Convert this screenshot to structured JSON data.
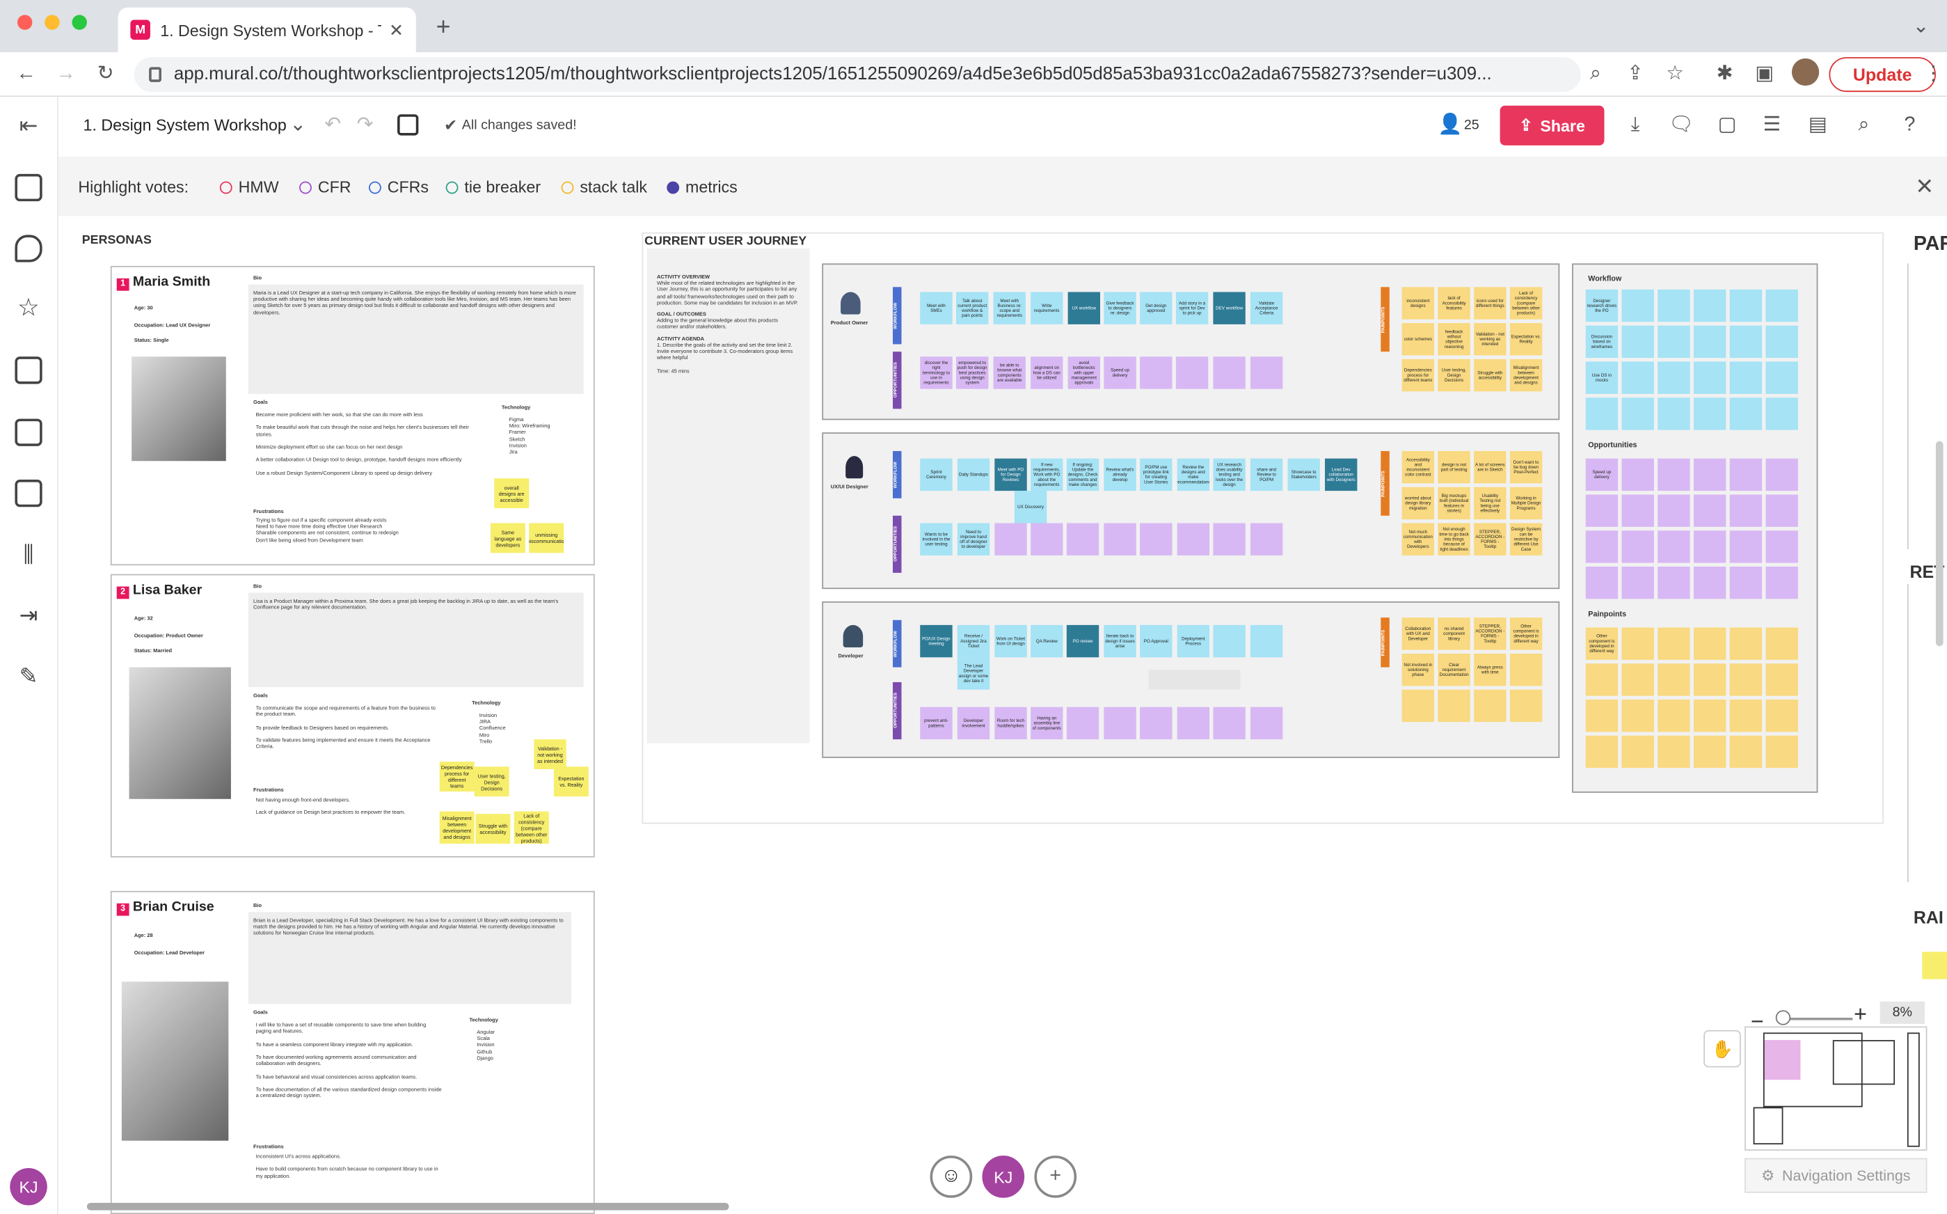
{
  "browser": {
    "tab_title": "1. Design System Workshop - T",
    "tab_favicon": "M",
    "url": "app.mural.co/t/thoughtworksclientprojects1205/m/thoughtworksclientprojects1205/1651255090269/a4d5e3e6b5d05d85a53ba931cc0a2ada67558273?sender=u309...",
    "update_label": "Update"
  },
  "app": {
    "room_title": "1. Design System Workshop",
    "saved_status": "All changes saved!",
    "collaborators_count": "25",
    "share_label": "Share",
    "user_initials": "KJ"
  },
  "votes": {
    "label": "Highlight votes:",
    "items": [
      {
        "label": "HMW",
        "color": "#e8365d"
      },
      {
        "label": "CFR",
        "color": "#a44ad1"
      },
      {
        "label": "CFRs",
        "color": "#3d6dd6"
      },
      {
        "label": "tie breaker",
        "color": "#2da287"
      },
      {
        "label": "stack talk",
        "color": "#f2b92b"
      },
      {
        "label": "metrics",
        "color": "#4b43a7"
      }
    ]
  },
  "canvas": {
    "personas_label": "PERSONAS",
    "journey_label": "CURRENT USER JOURNEY",
    "right_labels": [
      "PAR",
      "RET",
      "RAI"
    ],
    "personas": [
      {
        "num": "1",
        "name": "Maria Smith",
        "bio_label": "Bio",
        "age": "Age: 30",
        "occupation": "Occupation: Lead UX Designer",
        "status": "Status: Single",
        "bio": "Maria is a Lead UX Designer at a start-up tech company in California. She enjoys the flexibility of working remotely from home which is more productive with sharing her ideas and becoming quite handy with collaboration tools like Miro, Invision, and MS team. Her teams has been using Sketch for over 5 years as primary design tool but finds it difficult to collaborate and handoff designs with other designers and developers.",
        "goals_label": "Goals",
        "goals": [
          "Become more proficient with her work, so that she can do more with less",
          "To make beautiful work that cuts through the noise and helps her client's businesses tell their stories.",
          "Minimize deployment effort so she can focus on her next design",
          "A better collaboration UI Design tool to design, prototype, handoff designs more efficiently",
          "Use a robust Design System/Component Library to speed up design delivery"
        ],
        "tech_label": "Technology",
        "tech": [
          "Figma",
          "Miro: Wireframing",
          "Framer",
          "Sketch",
          "Invision",
          "Jira"
        ],
        "frustrations_label": "Frustrations",
        "frustrations": [
          "Trying to figure out if a specific component already exists",
          "Need to have more time doing effective User Research",
          "Sharable components are not consistent, continue to redesign",
          "Don't like being siloed from Development team"
        ],
        "stickies": [
          "overall designs are accessible",
          "Same language as developers",
          "unmissing miscommunication"
        ]
      },
      {
        "num": "2",
        "name": "Lisa Baker",
        "bio_label": "Bio",
        "age": "Age: 32",
        "occupation": "Occupation: Product Owner",
        "status": "Status: Married",
        "bio": "Lisa is a Product Manager within a Proxima team. She does a great job keeping the backlog in JIRA up to date, as well as the team's Confluence page for any relevent documentation.",
        "goals_label": "Goals",
        "goals": [
          "To communicate the scope and requirements of a feature from the business to the product team.",
          "To provide feedback to Designers based on requirements.",
          "To validate features being implemented and ensure it meets the Acceptance Criteria."
        ],
        "tech_label": "Technology",
        "tech": [
          "Invision",
          "JIRA",
          "Confluence",
          "Miro",
          "Trello"
        ],
        "frustrations_label": "Frustrations",
        "frustrations": [
          "Not having enough front-end developers.",
          "Lack of guidance on Design best practices to empower the team."
        ],
        "stickies": [
          "Validation - not working as intended",
          "Dependencies process for different teams",
          "User testing, Design Decisions",
          "Expectation vs. Reality",
          "Misalignment between development and designs",
          "Struggle with accessibility",
          "Lack of consistency (compare between other products)"
        ]
      },
      {
        "num": "3",
        "name": "Brian Cruise",
        "bio_label": "Bio",
        "age": "Age: 28",
        "occupation": "Occupation: Lead Developer",
        "bio": "Brian is a Lead Developer, specializing in Full Stack Development. He has a love for a consistent UI library with existing components to match the designs provided to him. He has a history of working with Angular and Angular Material. He currently develops innovative solutions for Norwegian Cruise line internal products.",
        "goals_label": "Goals",
        "goals": [
          "I will like to have a set of reusable components to save time when building paging and features.",
          "To have a seamless component library integrate with my application.",
          "To have documented working agreements around communication and collaboration with designers.",
          "To have behavioral and visual consistencies across application teams.",
          "To have documentation of all the various standardized design components inside a centralized design system."
        ],
        "tech_label": "Technology",
        "tech": [
          "Angular",
          "Scala",
          "Invision",
          "Github",
          "Django"
        ],
        "frustrations_label": "Frustrations",
        "frustrations": [
          "Inconsistent UI's across applications.",
          "Have to build components from scratch because no component library to use in my application."
        ]
      }
    ],
    "journey_info": {
      "overview_label": "ACTIVITY OVERVIEW",
      "overview": "While most of the related technologies are highlighted in the User Journey, this is an opportunity for participates to list any and all tools/ frameworks/technologies used on their path to production. Some may be candidates for inclusion in an MVP.",
      "goal_label": "GOAL / OUTCOMES",
      "goal": "Adding to the general knowledge about this products customer and/or stakeholders.",
      "agenda_label": "ACTIVITY AGENDA",
      "agenda": "1. Describe the goals of the activity and set the time limit  2. Invite everyone to contribute  3. Co-moderators group items where helpful",
      "time": "Time: 45 mins"
    },
    "journey_rows": [
      {
        "role": "Product Owner",
        "workflow": [
          "Meet with SMEs",
          "Talk about current product workflow & pain points",
          "Meet with Business re: scope and requirements",
          "Write requirements",
          "UX workflow",
          "Give feedback to designers re: design",
          "Get design approved",
          "Add story in a sprint for Dev to pick up",
          "DEV workflow",
          "Validate Acceptance Criteria"
        ],
        "opportunities": [
          "discover the right terminology to use in requirements",
          "empowered to push for design best practices using design system",
          "be able to browse what components are available",
          "alignment on how a DS can be utilized",
          "avoid bottlenecks with upper management approvals",
          "Speed up delivery"
        ],
        "painpoints": [
          "inconsistent designs",
          "lack of Accessibility features",
          "icons used for different things",
          "Lack of consistency (compare between other products)",
          "color schemes",
          "feedback without objective reasoning",
          "Validation - not working as intended",
          "Expectation vs. Reality",
          "Dependencies process for different teams",
          "User testing, Design Decisions",
          "Struggle with accessibility",
          "Misalignment between development and designs"
        ]
      },
      {
        "role": "UX/UI Designer",
        "workflow": [
          "Sprint Ceremony",
          "Daily Standups",
          "Meet with PO for Design Reviews",
          "If new requirements, Work with PO about the requirements",
          "If ongoing: Update the designs, Check comments and make changes",
          "Review what's already develop",
          "PO/PM use prototype link for creating User Stories",
          "Review the designs and make recommendations",
          "UX research does usability testing and looks over the design",
          "share and Review to PO/PM",
          "Showcase to Stakeholders",
          "Lead Dev collaboration with Designers",
          "UX Discovery"
        ],
        "opportunities": [
          "Wants to be involved in the user testing",
          "Need to improve hand off of designer to developer"
        ],
        "painpoints": [
          "Accessibility and inconsistent color contrast",
          "design is not part of testing",
          "A lot of screens are in Sketch",
          "Don't want to be bog down Pixel-Perfect",
          "worried about design library migration",
          "Big mockups built (individual features in stories)",
          "Usability Testing not being use effectively",
          "Working in Multiple Design Programs",
          "Not much communication with Developers",
          "Not enough time to go back into things because of tight deadlines",
          "STEPPER, ACCORDION - FORMS - Tooltip",
          "Design System can be restrictive by different Use Case"
        ]
      },
      {
        "role": "Developer",
        "workflow": [
          "PO/UX Design meeting",
          "Receive / Assigned Jira Ticket",
          "Work on Ticket from UI design",
          "QA Review",
          "PO review",
          "Iterate back to design if issues arise",
          "PO Approval",
          "Deployment Process",
          "The Lead Developer assign or some dev take it"
        ],
        "opportunities": [
          "prevent anti-patterns",
          "Developer involvement",
          "Room for tech huddle/spikes",
          "Having an assembly line of components"
        ],
        "painpoints": [
          "Collaboration with UX and Developer",
          "no shared component library",
          "STEPPER, ACCORDION - FORMS - Tooltip",
          "Other component is developed in different way",
          "Not involved in solutioning phase",
          "Clear requirement Documentation",
          "Always press with time"
        ]
      }
    ],
    "row_section_labels": {
      "workflow": "WORKFLOW",
      "opportunities": "OPPORTUNITIES",
      "painpoints": "PAINPOINTS"
    },
    "summary": {
      "workflow_label": "Workflow",
      "workflow_notes": [
        "Designer research drives the PO",
        "Discussion based on wireframes",
        "Use DS in mocks"
      ],
      "opportunities_label": "Opportunities",
      "opportunities_notes": [
        "Speed up delivery"
      ],
      "painpoints_label": "Painpoints",
      "painpoints_notes": [
        "Other component is developed in different way"
      ]
    }
  },
  "navigation": {
    "zoom_level": "8%",
    "zoom_minus": "−",
    "zoom_plus": "+",
    "settings_label": "Navigation Settings"
  },
  "icons": [
    "exit-icon",
    "sticky-note-icon",
    "comment-shape-icon",
    "star-icon",
    "image-icon",
    "grid-icon",
    "table-icon",
    "library-icon",
    "import-icon",
    "pen-icon",
    "undo-icon",
    "redo-icon",
    "timer-icon",
    "check-icon",
    "user-icon",
    "share-icon",
    "download-icon",
    "chat-icon",
    "comment-icon",
    "activity-icon",
    "outline-icon",
    "search-icon",
    "help-icon",
    "close-icon",
    "emoji-icon",
    "add-icon",
    "hand-icon",
    "gear-icon"
  ]
}
